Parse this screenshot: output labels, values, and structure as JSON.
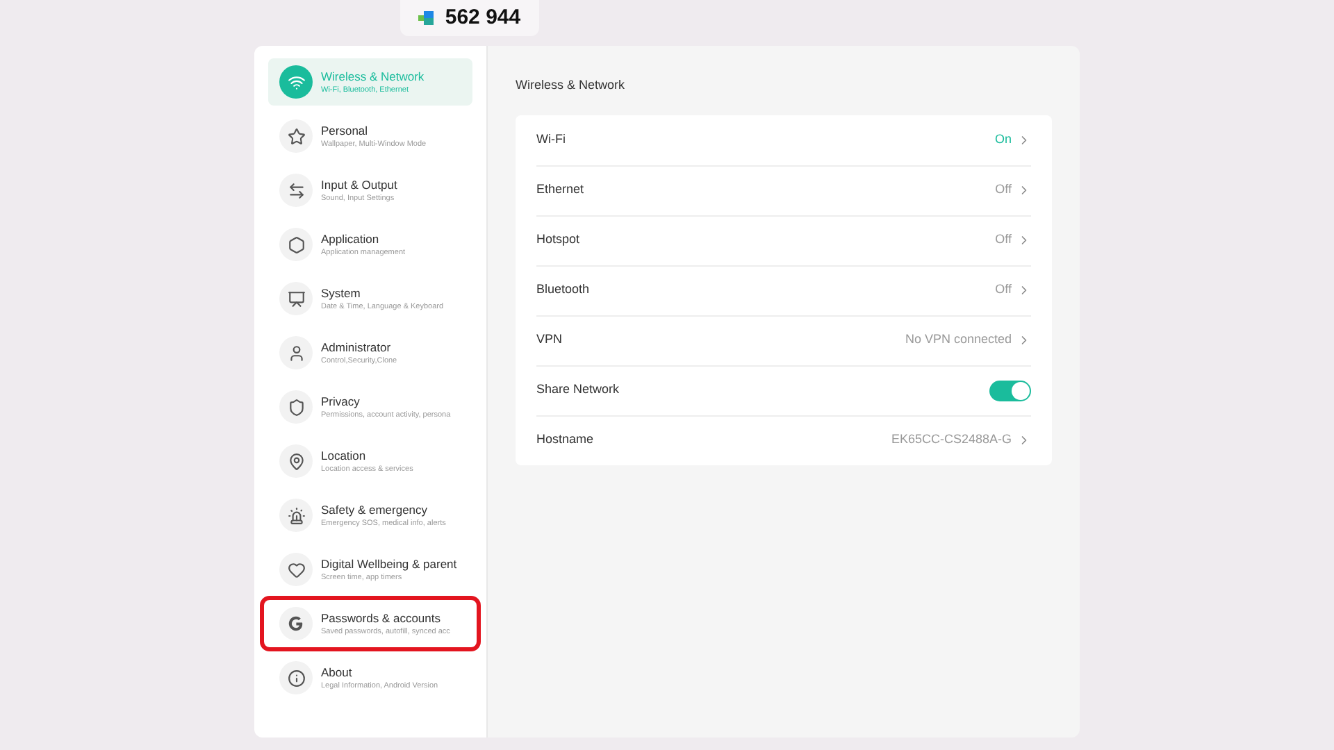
{
  "code_badge": {
    "text": "562 944"
  },
  "sidebar": {
    "items": [
      {
        "kind": "wifi",
        "title": "Wireless & Network",
        "subtitle": "Wi-Fi, Bluetooth, Ethernet",
        "selected": true,
        "highlighted": false
      },
      {
        "kind": "star",
        "title": "Personal",
        "subtitle": "Wallpaper, Multi-Window Mode",
        "selected": false,
        "highlighted": false
      },
      {
        "kind": "arrows",
        "title": "Input & Output",
        "subtitle": "Sound, Input Settings",
        "selected": false,
        "highlighted": false
      },
      {
        "kind": "box",
        "title": "Application",
        "subtitle": "Application management",
        "selected": false,
        "highlighted": false
      },
      {
        "kind": "monitor",
        "title": "System",
        "subtitle": "Date & Time, Language & Keyboard",
        "selected": false,
        "highlighted": false
      },
      {
        "kind": "user",
        "title": "Administrator",
        "subtitle": "Control,Security,Clone",
        "selected": false,
        "highlighted": false
      },
      {
        "kind": "shield",
        "title": "Privacy",
        "subtitle": "Permissions, account activity, persona",
        "selected": false,
        "highlighted": false
      },
      {
        "kind": "location",
        "title": "Location",
        "subtitle": "Location access & services",
        "selected": false,
        "highlighted": false
      },
      {
        "kind": "alarm",
        "title": "Safety & emergency",
        "subtitle": "Emergency SOS, medical info, alerts",
        "selected": false,
        "highlighted": false
      },
      {
        "kind": "wellbeing",
        "title": "Digital Wellbeing & parent",
        "subtitle": "Screen time, app timers",
        "selected": false,
        "highlighted": false
      },
      {
        "kind": "google",
        "title": "Passwords & accounts",
        "subtitle": "Saved passwords, autofill, synced acc",
        "selected": false,
        "highlighted": true
      },
      {
        "kind": "info",
        "title": "About",
        "subtitle": "Legal Information, Android Version",
        "selected": false,
        "highlighted": false
      }
    ]
  },
  "content": {
    "title": "Wireless & Network",
    "rows": [
      {
        "kind": "link",
        "label": "Wi-Fi",
        "value": "On",
        "active": true
      },
      {
        "kind": "link",
        "label": "Ethernet",
        "value": "Off",
        "active": false
      },
      {
        "kind": "link",
        "label": "Hotspot",
        "value": "Off",
        "active": false
      },
      {
        "kind": "link",
        "label": "Bluetooth",
        "value": "Off",
        "active": false
      },
      {
        "kind": "link",
        "label": "VPN",
        "value": "No VPN connected",
        "active": false
      },
      {
        "kind": "toggle",
        "label": "Share Network",
        "on": true
      },
      {
        "kind": "link",
        "label": "Hostname",
        "value": "EK65CC-CS2488A-G",
        "active": false
      }
    ]
  }
}
